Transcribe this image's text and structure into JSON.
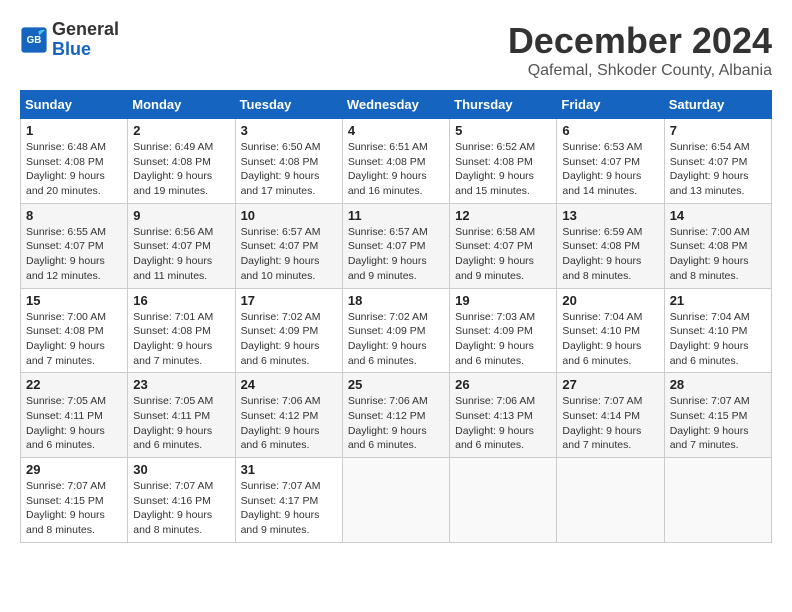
{
  "logo": {
    "text_general": "General",
    "text_blue": "Blue"
  },
  "header": {
    "title": "December 2024",
    "subtitle": "Qafemal, Shkoder County, Albania"
  },
  "weekdays": [
    "Sunday",
    "Monday",
    "Tuesday",
    "Wednesday",
    "Thursday",
    "Friday",
    "Saturday"
  ],
  "weeks": [
    [
      {
        "day": "1",
        "sunrise": "Sunrise: 6:48 AM",
        "sunset": "Sunset: 4:08 PM",
        "daylight": "Daylight: 9 hours and 20 minutes."
      },
      {
        "day": "2",
        "sunrise": "Sunrise: 6:49 AM",
        "sunset": "Sunset: 4:08 PM",
        "daylight": "Daylight: 9 hours and 19 minutes."
      },
      {
        "day": "3",
        "sunrise": "Sunrise: 6:50 AM",
        "sunset": "Sunset: 4:08 PM",
        "daylight": "Daylight: 9 hours and 17 minutes."
      },
      {
        "day": "4",
        "sunrise": "Sunrise: 6:51 AM",
        "sunset": "Sunset: 4:08 PM",
        "daylight": "Daylight: 9 hours and 16 minutes."
      },
      {
        "day": "5",
        "sunrise": "Sunrise: 6:52 AM",
        "sunset": "Sunset: 4:08 PM",
        "daylight": "Daylight: 9 hours and 15 minutes."
      },
      {
        "day": "6",
        "sunrise": "Sunrise: 6:53 AM",
        "sunset": "Sunset: 4:07 PM",
        "daylight": "Daylight: 9 hours and 14 minutes."
      },
      {
        "day": "7",
        "sunrise": "Sunrise: 6:54 AM",
        "sunset": "Sunset: 4:07 PM",
        "daylight": "Daylight: 9 hours and 13 minutes."
      }
    ],
    [
      {
        "day": "8",
        "sunrise": "Sunrise: 6:55 AM",
        "sunset": "Sunset: 4:07 PM",
        "daylight": "Daylight: 9 hours and 12 minutes."
      },
      {
        "day": "9",
        "sunrise": "Sunrise: 6:56 AM",
        "sunset": "Sunset: 4:07 PM",
        "daylight": "Daylight: 9 hours and 11 minutes."
      },
      {
        "day": "10",
        "sunrise": "Sunrise: 6:57 AM",
        "sunset": "Sunset: 4:07 PM",
        "daylight": "Daylight: 9 hours and 10 minutes."
      },
      {
        "day": "11",
        "sunrise": "Sunrise: 6:57 AM",
        "sunset": "Sunset: 4:07 PM",
        "daylight": "Daylight: 9 hours and 9 minutes."
      },
      {
        "day": "12",
        "sunrise": "Sunrise: 6:58 AM",
        "sunset": "Sunset: 4:07 PM",
        "daylight": "Daylight: 9 hours and 9 minutes."
      },
      {
        "day": "13",
        "sunrise": "Sunrise: 6:59 AM",
        "sunset": "Sunset: 4:08 PM",
        "daylight": "Daylight: 9 hours and 8 minutes."
      },
      {
        "day": "14",
        "sunrise": "Sunrise: 7:00 AM",
        "sunset": "Sunset: 4:08 PM",
        "daylight": "Daylight: 9 hours and 8 minutes."
      }
    ],
    [
      {
        "day": "15",
        "sunrise": "Sunrise: 7:00 AM",
        "sunset": "Sunset: 4:08 PM",
        "daylight": "Daylight: 9 hours and 7 minutes."
      },
      {
        "day": "16",
        "sunrise": "Sunrise: 7:01 AM",
        "sunset": "Sunset: 4:08 PM",
        "daylight": "Daylight: 9 hours and 7 minutes."
      },
      {
        "day": "17",
        "sunrise": "Sunrise: 7:02 AM",
        "sunset": "Sunset: 4:09 PM",
        "daylight": "Daylight: 9 hours and 6 minutes."
      },
      {
        "day": "18",
        "sunrise": "Sunrise: 7:02 AM",
        "sunset": "Sunset: 4:09 PM",
        "daylight": "Daylight: 9 hours and 6 minutes."
      },
      {
        "day": "19",
        "sunrise": "Sunrise: 7:03 AM",
        "sunset": "Sunset: 4:09 PM",
        "daylight": "Daylight: 9 hours and 6 minutes."
      },
      {
        "day": "20",
        "sunrise": "Sunrise: 7:04 AM",
        "sunset": "Sunset: 4:10 PM",
        "daylight": "Daylight: 9 hours and 6 minutes."
      },
      {
        "day": "21",
        "sunrise": "Sunrise: 7:04 AM",
        "sunset": "Sunset: 4:10 PM",
        "daylight": "Daylight: 9 hours and 6 minutes."
      }
    ],
    [
      {
        "day": "22",
        "sunrise": "Sunrise: 7:05 AM",
        "sunset": "Sunset: 4:11 PM",
        "daylight": "Daylight: 9 hours and 6 minutes."
      },
      {
        "day": "23",
        "sunrise": "Sunrise: 7:05 AM",
        "sunset": "Sunset: 4:11 PM",
        "daylight": "Daylight: 9 hours and 6 minutes."
      },
      {
        "day": "24",
        "sunrise": "Sunrise: 7:06 AM",
        "sunset": "Sunset: 4:12 PM",
        "daylight": "Daylight: 9 hours and 6 minutes."
      },
      {
        "day": "25",
        "sunrise": "Sunrise: 7:06 AM",
        "sunset": "Sunset: 4:12 PM",
        "daylight": "Daylight: 9 hours and 6 minutes."
      },
      {
        "day": "26",
        "sunrise": "Sunrise: 7:06 AM",
        "sunset": "Sunset: 4:13 PM",
        "daylight": "Daylight: 9 hours and 6 minutes."
      },
      {
        "day": "27",
        "sunrise": "Sunrise: 7:07 AM",
        "sunset": "Sunset: 4:14 PM",
        "daylight": "Daylight: 9 hours and 7 minutes."
      },
      {
        "day": "28",
        "sunrise": "Sunrise: 7:07 AM",
        "sunset": "Sunset: 4:15 PM",
        "daylight": "Daylight: 9 hours and 7 minutes."
      }
    ],
    [
      {
        "day": "29",
        "sunrise": "Sunrise: 7:07 AM",
        "sunset": "Sunset: 4:15 PM",
        "daylight": "Daylight: 9 hours and 8 minutes."
      },
      {
        "day": "30",
        "sunrise": "Sunrise: 7:07 AM",
        "sunset": "Sunset: 4:16 PM",
        "daylight": "Daylight: 9 hours and 8 minutes."
      },
      {
        "day": "31",
        "sunrise": "Sunrise: 7:07 AM",
        "sunset": "Sunset: 4:17 PM",
        "daylight": "Daylight: 9 hours and 9 minutes."
      },
      null,
      null,
      null,
      null
    ]
  ]
}
